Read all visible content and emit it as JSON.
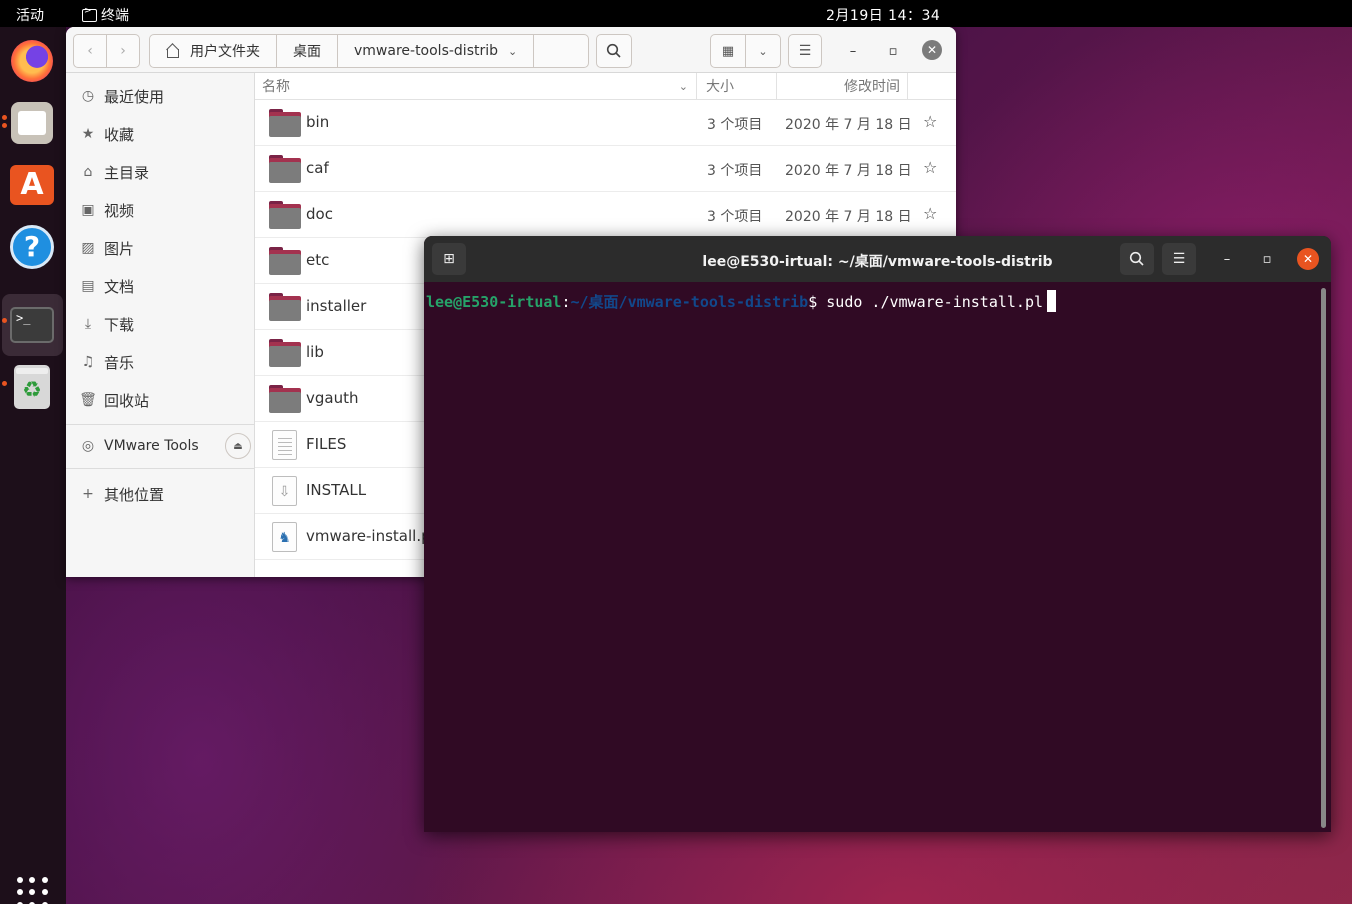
{
  "topbar": {
    "activities": "活动",
    "app_name": "终端",
    "clock": "2月19日  14：34"
  },
  "dock": {
    "items": [
      "firefox-icon",
      "files-icon",
      "software-store-icon",
      "help-icon",
      "terminal-icon",
      "trash-icon"
    ]
  },
  "files": {
    "path": [
      "用户文件夹",
      "桌面",
      "vmware-tools-distrib"
    ],
    "columns": {
      "name": "名称",
      "size": "大小",
      "modified": "修改时间"
    },
    "sidebar": {
      "places": [
        {
          "label": "最近使用",
          "icon": "clock-icon"
        },
        {
          "label": "收藏",
          "icon": "star-icon"
        },
        {
          "label": "主目录",
          "icon": "home-icon"
        },
        {
          "label": "视频",
          "icon": "video-icon"
        },
        {
          "label": "图片",
          "icon": "image-icon"
        },
        {
          "label": "文档",
          "icon": "document-icon"
        },
        {
          "label": "下载",
          "icon": "download-icon"
        },
        {
          "label": "音乐",
          "icon": "music-icon"
        },
        {
          "label": "回收站",
          "icon": "trash-icon"
        }
      ],
      "device": "VMware Tools",
      "other": "其他位置"
    },
    "rows": [
      {
        "name": "bin",
        "type": "folder",
        "size": "3 个项目",
        "date": "2020 年 7 月 18 日"
      },
      {
        "name": "caf",
        "type": "folder",
        "size": "3 个项目",
        "date": "2020 年 7 月 18 日"
      },
      {
        "name": "doc",
        "type": "folder",
        "size": "3 个项目",
        "date": "2020 年 7 月 18 日"
      },
      {
        "name": "etc",
        "type": "folder",
        "size": "",
        "date": ""
      },
      {
        "name": "installer",
        "type": "folder",
        "size": "",
        "date": ""
      },
      {
        "name": "lib",
        "type": "folder",
        "size": "",
        "date": ""
      },
      {
        "name": "vgauth",
        "type": "folder",
        "size": "",
        "date": ""
      },
      {
        "name": "FILES",
        "type": "text",
        "size": "",
        "date": ""
      },
      {
        "name": "INSTALL",
        "type": "text",
        "size": "",
        "date": ""
      },
      {
        "name": "vmware-install.pl",
        "type": "script",
        "size": "",
        "date": ""
      }
    ]
  },
  "terminal": {
    "title": "lee@E530-irtual: ~/桌面/vmware-tools-distrib",
    "prompt_user": "lee@E530-irtual",
    "prompt_sep": ":",
    "prompt_path": "~/桌面/vmware-tools-distrib",
    "prompt_symbol": "$ ",
    "command": "sudo ./vmware-install.pl"
  },
  "colors": {
    "accent": "#e95420",
    "terminal_bg": "#300a24",
    "prompt_user": "#26a269",
    "prompt_path": "#12488b"
  }
}
